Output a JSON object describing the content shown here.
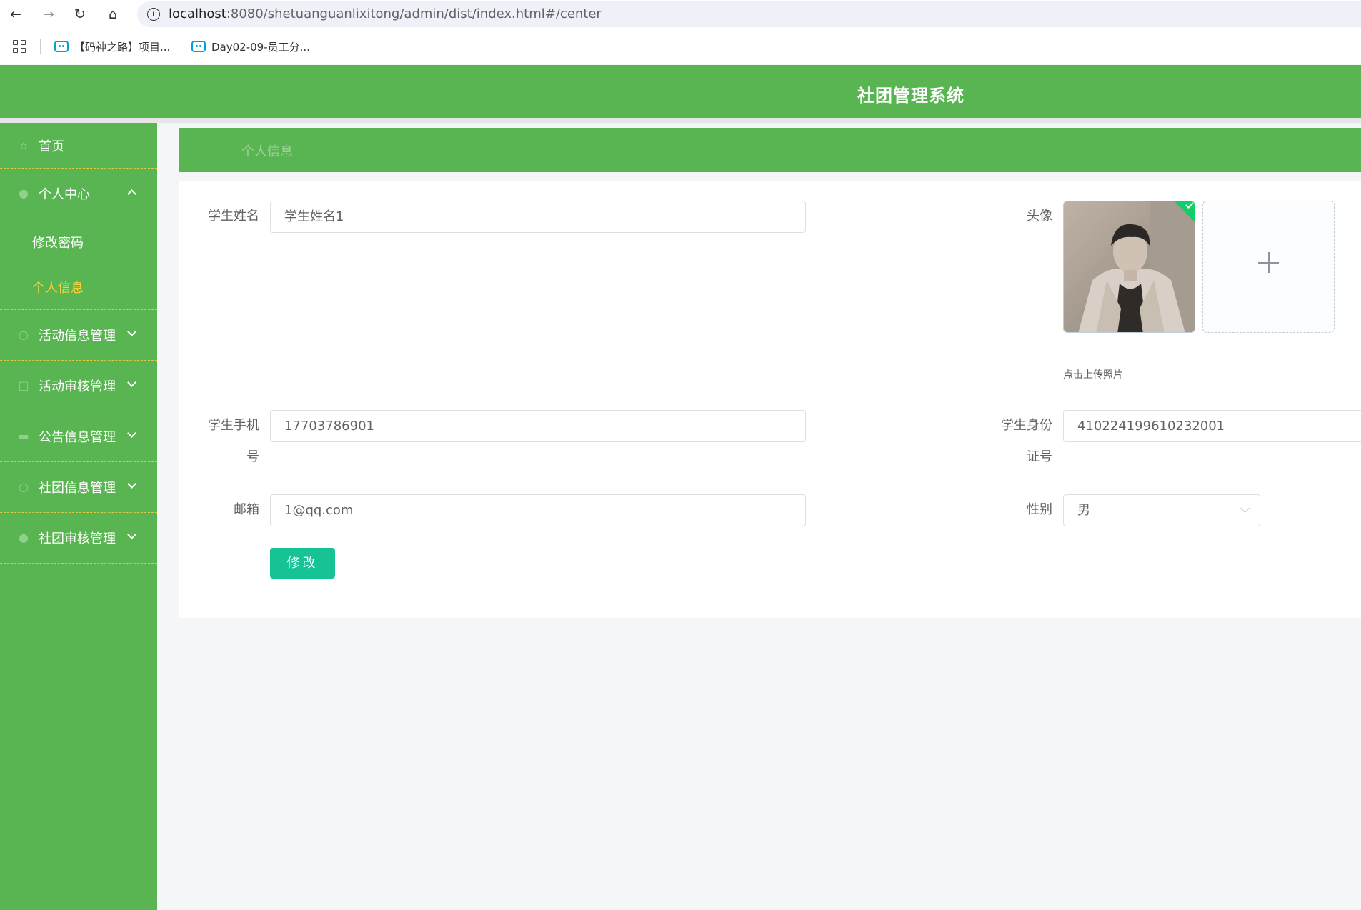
{
  "browser": {
    "url_host": "localhost",
    "url_rest": ":8080/shetuanguanlixitong/admin/dist/index.html#/center",
    "bookmarks": [
      {
        "label": "【码神之路】项目..."
      },
      {
        "label": "Day02-09-员工分..."
      }
    ]
  },
  "header": {
    "title": "社团管理系统"
  },
  "sidebar": {
    "home": "首页",
    "personal_center": "个人中心",
    "sub_items": [
      "修改密码",
      "个人信息"
    ],
    "menus": [
      "活动信息管理",
      "活动审核管理",
      "公告信息管理",
      "社团信息管理",
      "社团审核管理"
    ]
  },
  "breadcrumb": "个人信息",
  "form": {
    "name_label": "学生姓名",
    "name_value": "学生姓名1",
    "avatar_label": "头像",
    "upload_tip": "点击上传照片",
    "phone_label_1": "学生手机",
    "phone_label_2": "号",
    "phone_value": "17703786901",
    "idcard_label_1": "学生身份",
    "idcard_label_2": "证号",
    "idcard_value": "410224199610232001",
    "email_label": "邮箱",
    "email_value": "1@qq.com",
    "gender_label": "性别",
    "gender_value": "男",
    "submit_label": "修改"
  }
}
